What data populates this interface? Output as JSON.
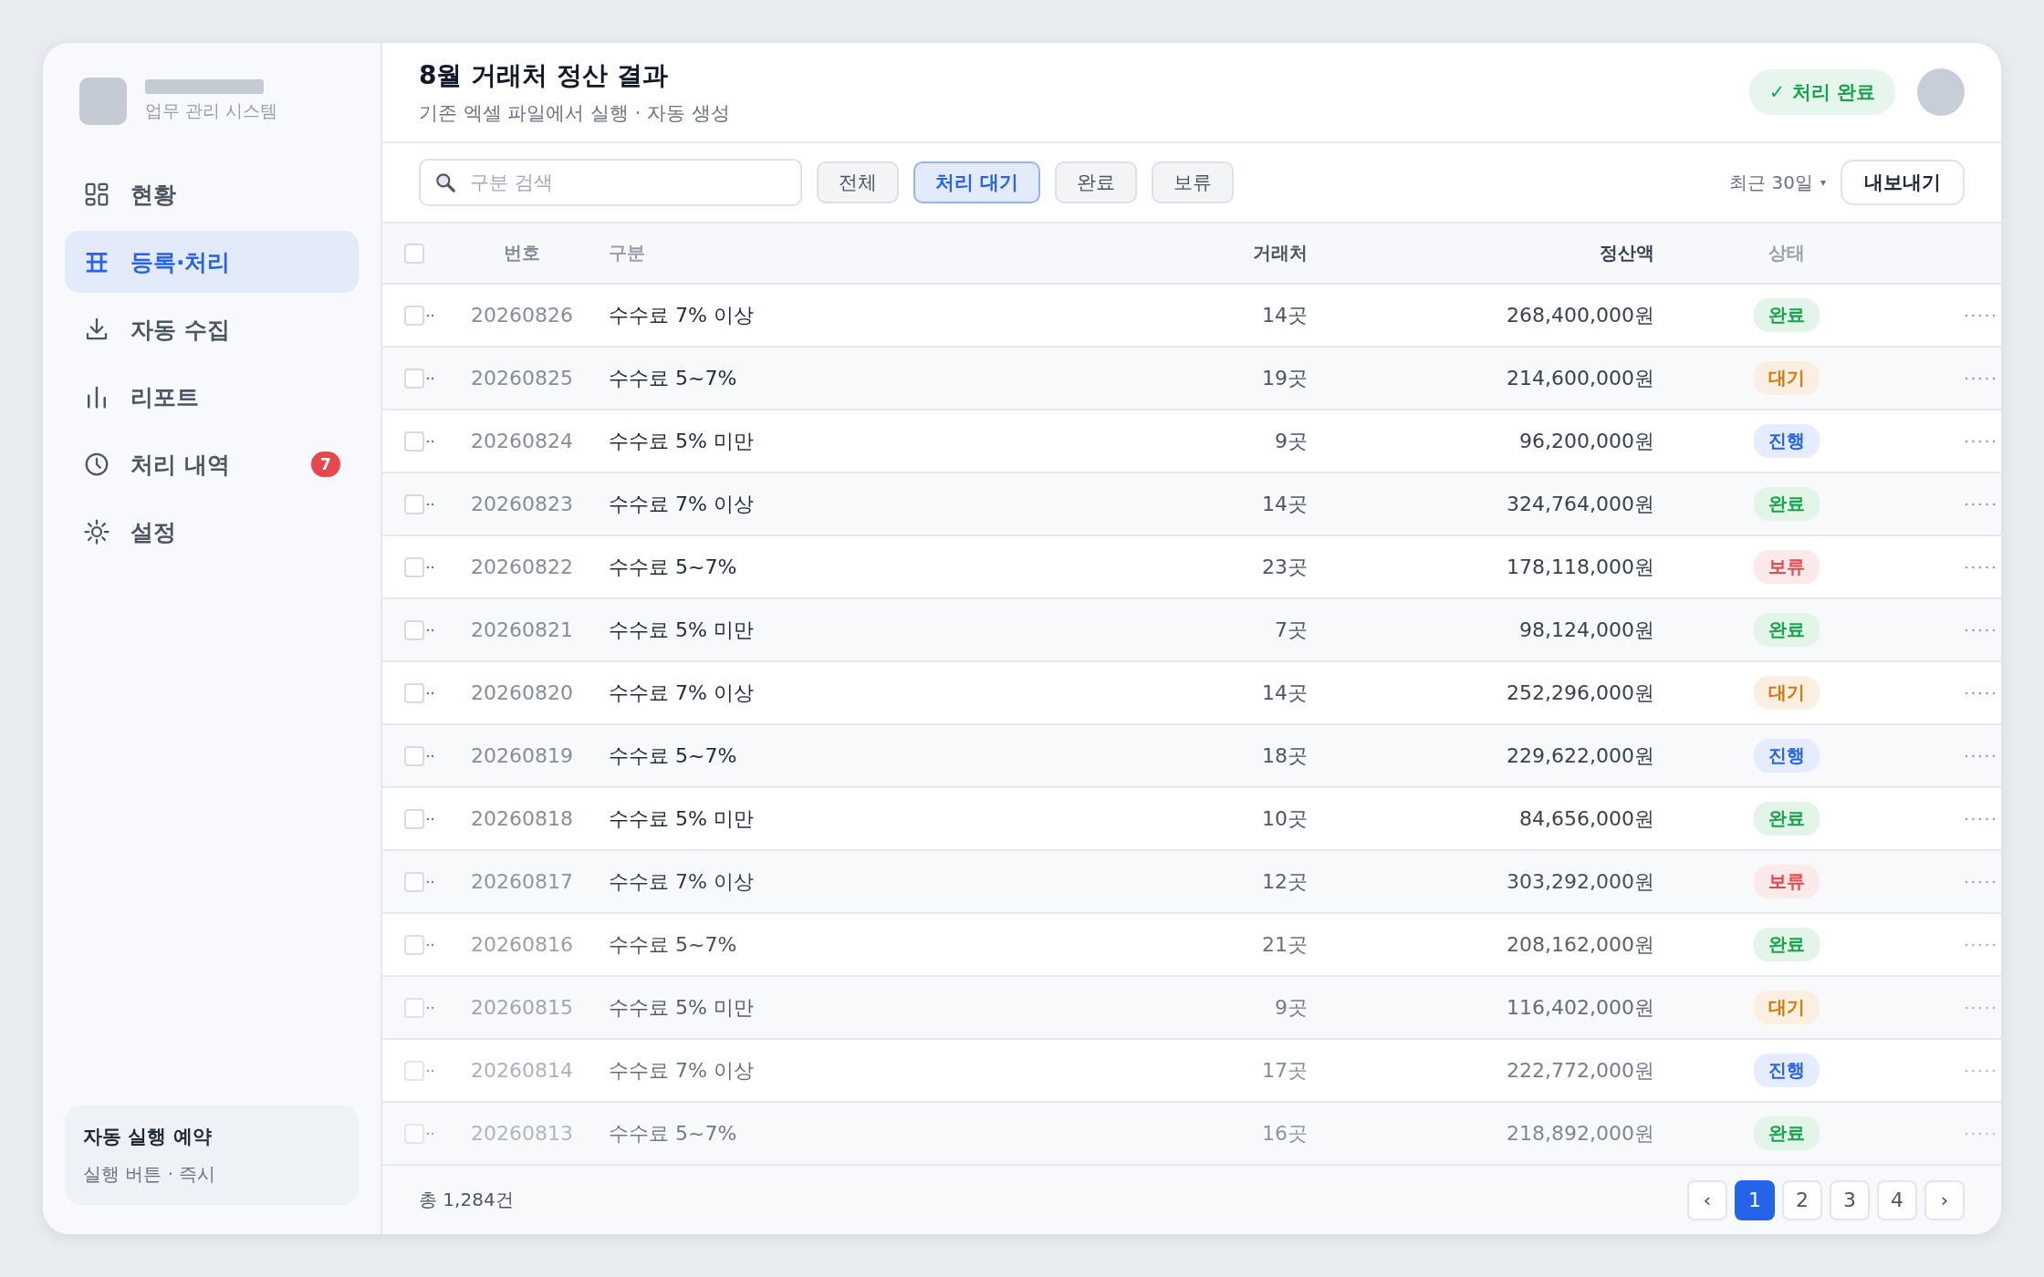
{
  "sidebar": {
    "app_subtitle": "업무 관리 시스템",
    "items": [
      {
        "label": "현황",
        "selected": false
      },
      {
        "label": "등록·처리",
        "selected": true
      },
      {
        "label": "자동 수집",
        "selected": false
      },
      {
        "label": "리포트",
        "selected": false
      },
      {
        "label": "처리 내역",
        "selected": false,
        "badge": "7"
      },
      {
        "label": "설정",
        "selected": false
      }
    ],
    "schedule_card": {
      "title": "자동 실행 예약",
      "subtitle": "실행 버튼 · 즉시"
    }
  },
  "header": {
    "title": "8월 거래처 정산 결과",
    "subtitle": "기존 엑셀 파일에서 실행 · 자동 생성",
    "status_pill": "✓ 처리 완료"
  },
  "toolbar": {
    "search": {
      "placeholder": "구분 검색"
    },
    "filters": [
      {
        "label": "전체",
        "selected": false
      },
      {
        "label": "처리 대기",
        "selected": true
      },
      {
        "label": "완료",
        "selected": false
      },
      {
        "label": "보류",
        "selected": false
      }
    ],
    "period": "최근 30일",
    "period_caret": "▾",
    "export_button": "내보내기"
  },
  "table": {
    "select_all_checked": false,
    "columns": [
      "번호",
      "구분",
      "거래처",
      "정산액",
      "상태"
    ],
    "rows": [
      {
        "checked": false,
        "number": "20260826",
        "category": "수수료 7% 이상",
        "vendors": "14곳",
        "amount": "268,400,000원",
        "status": "완료",
        "color": "#16a34a"
      },
      {
        "checked": false,
        "number": "20260825",
        "category": "수수료 5~7%",
        "vendors": "19곳",
        "amount": "214,600,000원",
        "status": "대기",
        "color": "#d97706"
      },
      {
        "checked": false,
        "number": "20260824",
        "category": "수수료 5% 미만",
        "vendors": "9곳",
        "amount": "96,200,000원",
        "status": "진행",
        "color": "#2563eb"
      },
      {
        "checked": false,
        "number": "20260823",
        "category": "수수료 7% 이상",
        "vendors": "14곳",
        "amount": "324,764,000원",
        "status": "완료",
        "color": "#16a34a"
      },
      {
        "checked": false,
        "number": "20260822",
        "category": "수수료 5~7%",
        "vendors": "23곳",
        "amount": "178,118,000원",
        "status": "보류",
        "color": "#e5484d"
      },
      {
        "checked": false,
        "number": "20260821",
        "category": "수수료 5% 미만",
        "vendors": "7곳",
        "amount": "98,124,000원",
        "status": "완료",
        "color": "#16a34a"
      },
      {
        "checked": false,
        "number": "20260820",
        "category": "수수료 7% 이상",
        "vendors": "14곳",
        "amount": "252,296,000원",
        "status": "대기",
        "color": "#d97706"
      },
      {
        "checked": false,
        "number": "20260819",
        "category": "수수료 5~7%",
        "vendors": "18곳",
        "amount": "229,622,000원",
        "status": "진행",
        "color": "#2563eb"
      },
      {
        "checked": false,
        "number": "20260818",
        "category": "수수료 5% 미만",
        "vendors": "10곳",
        "amount": "84,656,000원",
        "status": "완료",
        "color": "#16a34a"
      },
      {
        "checked": false,
        "number": "20260817",
        "category": "수수료 7% 이상",
        "vendors": "12곳",
        "amount": "303,292,000원",
        "status": "보류",
        "color": "#e5484d"
      },
      {
        "checked": false,
        "number": "20260816",
        "category": "수수료 5~7%",
        "vendors": "21곳",
        "amount": "208,162,000원",
        "status": "완료",
        "color": "#16a34a"
      },
      {
        "checked": false,
        "number": "20260815",
        "category": "수수료 5% 미만",
        "vendors": "9곳",
        "amount": "116,402,000원",
        "status": "대기",
        "color": "#d97706"
      },
      {
        "checked": false,
        "number": "20260814",
        "category": "수수료 7% 이상",
        "vendors": "17곳",
        "amount": "222,772,000원",
        "status": "진행",
        "color": "#2563eb"
      },
      {
        "checked": false,
        "number": "20260813",
        "category": "수수료 5~7%",
        "vendors": "16곳",
        "amount": "218,892,000원",
        "status": "완료",
        "color": "#16a34a"
      }
    ]
  },
  "footer": {
    "total": "총 1,284건",
    "pagination": {
      "prev": "‹",
      "pages": [
        {
          "label": "1",
          "selected": true
        },
        {
          "label": "2",
          "selected": false
        },
        {
          "label": "3",
          "selected": false
        },
        {
          "label": "4",
          "selected": false
        }
      ],
      "next": "›"
    }
  }
}
